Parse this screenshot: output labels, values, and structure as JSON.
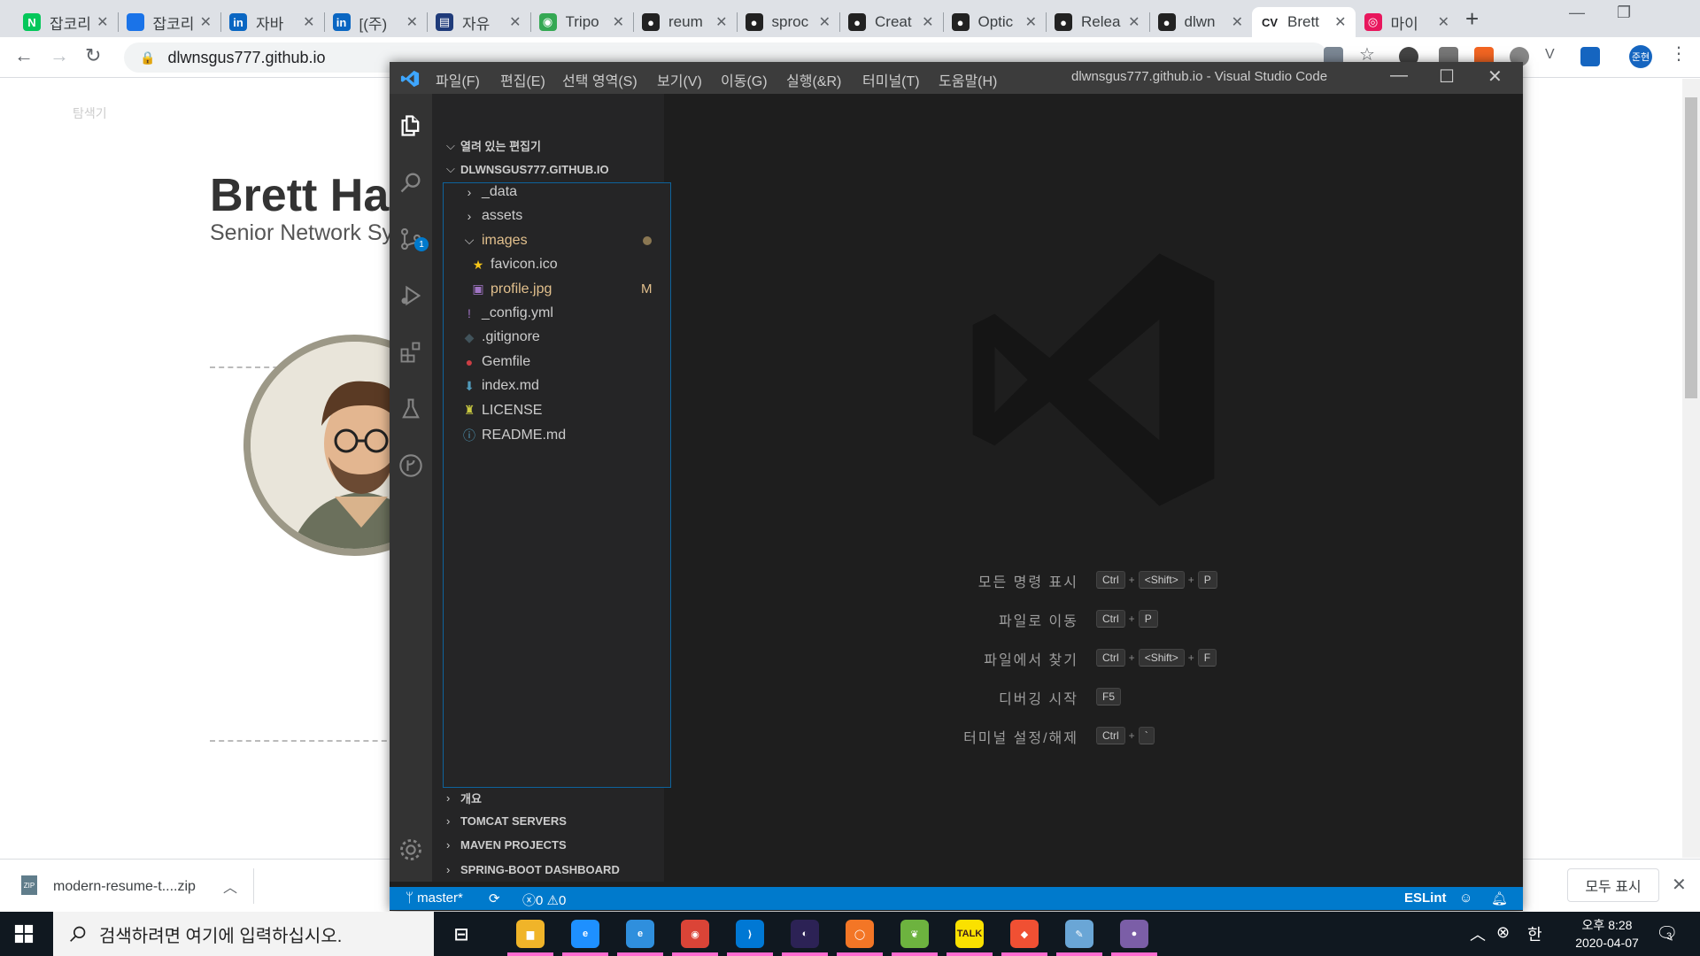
{
  "browser": {
    "tabs": [
      {
        "title": "잡코리",
        "icon": "naver-icon",
        "color": "#03c75a",
        "glyph": "N"
      },
      {
        "title": "잡코리",
        "icon": "chat-bubble-icon",
        "color": "#1a73e8",
        "glyph": ""
      },
      {
        "title": "자바",
        "icon": "linkedin-icon",
        "color": "#0a66c2",
        "glyph": "in"
      },
      {
        "title": "[(주)",
        "icon": "linkedin-icon",
        "color": "#0a66c2",
        "glyph": "in"
      },
      {
        "title": "자유",
        "icon": "notion-style-icon",
        "color": "#1f3b7a",
        "glyph": "▤"
      },
      {
        "title": "Tripo",
        "icon": "shield-icon",
        "color": "#34a853",
        "glyph": "◉"
      },
      {
        "title": "reum",
        "icon": "github-icon",
        "color": "#222",
        "glyph": "●"
      },
      {
        "title": "sproc",
        "icon": "github-icon",
        "color": "#222",
        "glyph": "●"
      },
      {
        "title": "Creat",
        "icon": "github-icon",
        "color": "#222",
        "glyph": "●"
      },
      {
        "title": "Optic",
        "icon": "github-icon",
        "color": "#222",
        "glyph": "●"
      },
      {
        "title": "Relea",
        "icon": "github-icon",
        "color": "#222",
        "glyph": "●"
      },
      {
        "title": "dlwn",
        "icon": "github-icon",
        "color": "#222",
        "glyph": "●"
      },
      {
        "title": "Brett",
        "icon": "cv-icon",
        "color": "#ffffff",
        "glyph": "CV",
        "active": true
      },
      {
        "title": "마이",
        "icon": "circle-logo-icon",
        "color": "#e8175d",
        "glyph": "◎"
      }
    ],
    "url": "dlwnsgus777.github.io"
  },
  "page": {
    "name": "Brett Har",
    "title": "Senior Network Sy"
  },
  "downloads": {
    "file": "modern-resume-t....zip",
    "show_all": "모두 표시"
  },
  "vscode": {
    "menus": [
      "파일(F)",
      "편집(E)",
      "선택 영역(S)",
      "보기(V)",
      "이동(G)",
      "실행(&R)",
      "터미널(T)",
      "도움말(H)"
    ],
    "window_title": "dlwnsgus777.github.io - Visual Studio Code",
    "explorer_title": "탐색기",
    "open_editors": "열려 있는 편집기",
    "workspace": "DLWNSGUS777.GITHUB.IO",
    "tree": [
      {
        "name": "_data",
        "kind": "folder-closed",
        "depth": 0
      },
      {
        "name": "assets",
        "kind": "folder-closed",
        "depth": 0
      },
      {
        "name": "images",
        "kind": "folder-open",
        "depth": 0,
        "modified": true
      },
      {
        "name": "favicon.ico",
        "kind": "favicon",
        "depth": 1
      },
      {
        "name": "profile.jpg",
        "kind": "image",
        "depth": 1,
        "modified": true,
        "git": "M"
      },
      {
        "name": "_config.yml",
        "kind": "yaml",
        "depth": 0
      },
      {
        "name": ".gitignore",
        "kind": "git",
        "depth": 0
      },
      {
        "name": "Gemfile",
        "kind": "ruby",
        "depth": 0
      },
      {
        "name": "index.md",
        "kind": "markdown",
        "depth": 0
      },
      {
        "name": "LICENSE",
        "kind": "license",
        "depth": 0
      },
      {
        "name": "README.md",
        "kind": "info",
        "depth": 0
      }
    ],
    "bottom_sections": [
      "개요",
      "TOMCAT SERVERS",
      "MAVEN PROJECTS",
      "SPRING-BOOT DASHBOARD"
    ],
    "scm_badge": "1",
    "shortcuts": [
      {
        "label": "모든 명령 표시",
        "keys": [
          "Ctrl",
          "+",
          "<Shift>",
          "+",
          "P"
        ]
      },
      {
        "label": "파일로 이동",
        "keys": [
          "Ctrl",
          "+",
          "P"
        ]
      },
      {
        "label": "파일에서 찾기",
        "keys": [
          "Ctrl",
          "+",
          "<Shift>",
          "+",
          "F"
        ]
      },
      {
        "label": "디버깅 시작",
        "keys": [
          "F5"
        ]
      },
      {
        "label": "터미널 설정/해제",
        "keys": [
          "Ctrl",
          "+",
          "`"
        ]
      }
    ],
    "status": {
      "branch": "master*",
      "errors": "0",
      "warnings": "0",
      "eslint": "ESLint"
    }
  },
  "taskbar": {
    "search_placeholder": "검색하려면 여기에 입력하십시오.",
    "apps": [
      {
        "name": "file-explorer-icon",
        "color": "#f0b429",
        "glyph": "▆"
      },
      {
        "name": "edge-legacy-icon",
        "color": "#1e90ff",
        "glyph": "e"
      },
      {
        "name": "internet-explorer-icon",
        "color": "#2f8fdd",
        "glyph": "e"
      },
      {
        "name": "chrome-icon",
        "color": "#db4437",
        "glyph": "◉"
      },
      {
        "name": "vscode-icon",
        "color": "#0078d4",
        "glyph": "⟩"
      },
      {
        "name": "eclipse-icon",
        "color": "#2c2255",
        "glyph": "◐"
      },
      {
        "name": "jupyter-icon",
        "color": "#f37626",
        "glyph": "◯"
      },
      {
        "name": "spring-icon",
        "color": "#6db33f",
        "glyph": "❦"
      },
      {
        "name": "kakaotalk-icon",
        "color": "#fae100",
        "glyph": "TALK"
      },
      {
        "name": "git-icon",
        "color": "#f05033",
        "glyph": "◆"
      },
      {
        "name": "paint-icon",
        "color": "#6aa6d6",
        "glyph": "✎"
      },
      {
        "name": "github-desktop-icon",
        "color": "#7b5ea7",
        "glyph": "●"
      }
    ],
    "ime": "한",
    "time": "오후 8:28",
    "date": "2020-04-07",
    "notify_count": "3"
  }
}
